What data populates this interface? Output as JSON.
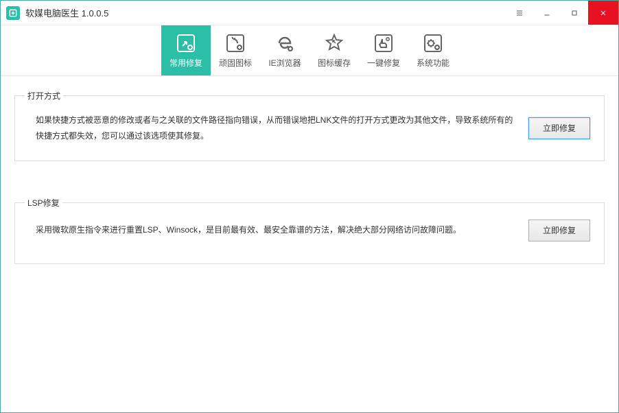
{
  "window": {
    "title": "软媒电脑医生 1.0.0.5"
  },
  "toolbar": {
    "items": [
      {
        "label": "常用修复",
        "icon": "shortcut-repair-icon"
      },
      {
        "label": "顽固图标",
        "icon": "stubborn-icon"
      },
      {
        "label": "IE浏览器",
        "icon": "ie-browser-icon"
      },
      {
        "label": "图标缓存",
        "icon": "icon-cache-icon"
      },
      {
        "label": "一键修复",
        "icon": "one-click-icon"
      },
      {
        "label": "系统功能",
        "icon": "system-func-icon"
      }
    ]
  },
  "panels": [
    {
      "title": "打开方式",
      "description": "如果快捷方式被恶意的修改或者与之关联的文件路径指向错误，从而错误地把LNK文件的打开方式更改为其他文件，导致系统所有的快捷方式都失效，您可以通过该选项使其修复。",
      "button": "立即修复"
    },
    {
      "title": "LSP修复",
      "description": "采用微软原生指令来进行重置LSP、Winsock，是目前最有效、最安全靠谱的方法，解决绝大部分网络访问故障问题。",
      "button": "立即修复"
    }
  ]
}
